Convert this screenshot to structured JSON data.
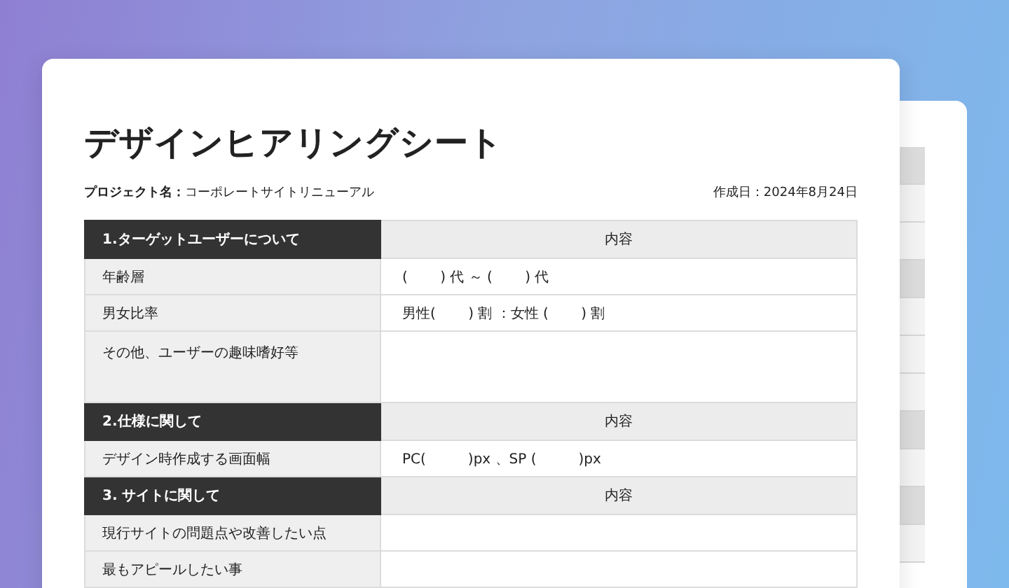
{
  "title": "デザインヒアリングシート",
  "project": {
    "label": "プロジェクト名：",
    "value": "コーポレートサイトリニューアル"
  },
  "created": "作成日：2024年8月24日",
  "sections": [
    {
      "heading": "1.ターゲットユーザーについて",
      "content_header": "内容",
      "rows": [
        {
          "kind": "short",
          "label": "年齢層",
          "value": "(　　 ) 代 ～ (　　 ) 代"
        },
        {
          "kind": "short",
          "label": "男女比率",
          "value": "男性(　　 ) 割 ：女性 (　　 ) 割"
        },
        {
          "kind": "tall",
          "label": "その他、ユーザーの趣味嗜好等"
        }
      ]
    },
    {
      "heading": "2.仕様に関して",
      "content_header": "内容",
      "rows": [
        {
          "kind": "short",
          "label": "デザイン時作成する画面幅",
          "value": "PC(　　　)px 、SP (　　　)px"
        }
      ]
    },
    {
      "heading": "3. サイトに関して",
      "content_header": "内容",
      "rows": [
        {
          "kind": "short",
          "label": "現行サイトの問題点や改善したい点"
        },
        {
          "kind": "short",
          "label": "最もアピールしたい事"
        }
      ]
    }
  ]
}
